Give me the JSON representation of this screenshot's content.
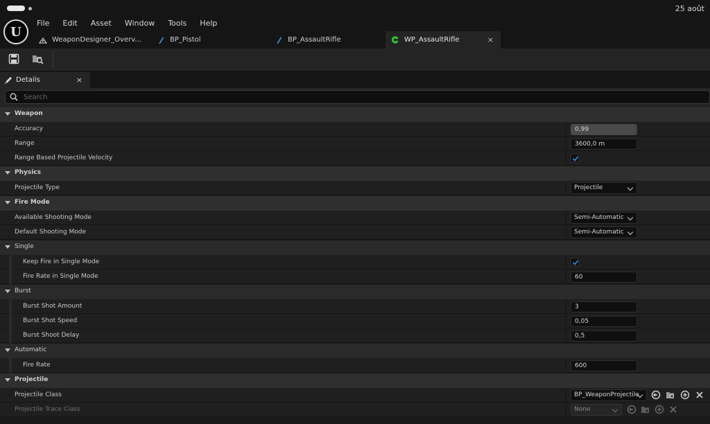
{
  "system": {
    "clock": "25 août"
  },
  "app": {
    "logo_text": "U"
  },
  "menu": [
    "File",
    "Edit",
    "Asset",
    "Window",
    "Tools",
    "Help"
  ],
  "tabs": [
    {
      "label": "WeaponDesigner_Overv...",
      "icon": "level-icon",
      "active": false
    },
    {
      "label": "BP_Pistol",
      "icon": "blueprint-icon",
      "active": false
    },
    {
      "label": "BP_AssaultRifle",
      "icon": "blueprint-icon",
      "active": false
    },
    {
      "label": "WP_AssaultRifle",
      "icon": "weapon-asset-icon",
      "active": true,
      "close": "×"
    }
  ],
  "toolbar": {
    "buttons": [
      "save-icon",
      "browse-icon"
    ]
  },
  "panel": {
    "title": "Details",
    "close": "×"
  },
  "search": {
    "placeholder": "Search"
  },
  "properties": {
    "weapon": {
      "title": "Weapon",
      "accuracy": {
        "label": "Accuracy",
        "value": "0,99",
        "fill": 0.99
      },
      "range": {
        "label": "Range",
        "value": "3600,0 m"
      },
      "range_based": {
        "label": "Range Based Projectile Velocity",
        "checked": true
      }
    },
    "physics": {
      "title": "Physics",
      "projectile_type": {
        "label": "Projectile Type",
        "value": "Projectile"
      }
    },
    "fire_mode": {
      "title": "Fire Mode",
      "available": {
        "label": "Available Shooting Mode",
        "value": "Semi-Automatic"
      },
      "default": {
        "label": "Default Shooting Mode",
        "value": "Semi-Automatic"
      }
    },
    "single": {
      "title": "Single",
      "keep_fire": {
        "label": "Keep Fire in Single Mode",
        "checked": true
      },
      "fire_rate": {
        "label": "Fire Rate in Single Mode",
        "value": "60"
      }
    },
    "burst": {
      "title": "Burst",
      "amount": {
        "label": "Burst Shot Amount",
        "value": "3"
      },
      "speed": {
        "label": "Burst Shot Speed",
        "value": "0,05"
      },
      "delay": {
        "label": "Burst Shoot Delay",
        "value": "0,5"
      }
    },
    "automatic": {
      "title": "Automatic",
      "fire_rate": {
        "label": "Fire Rate",
        "value": "600"
      }
    },
    "projectile": {
      "title": "Projectile",
      "class": {
        "label": "Projectile Class",
        "value": "BP_WeaponProjectile"
      },
      "trace_class": {
        "label": "Projectile Trace Class",
        "value": "None"
      }
    }
  },
  "colors": {
    "accent": "#2f6fd0",
    "active_tab_icon": "#2bd12b",
    "checkmark": "#3d8be8"
  }
}
